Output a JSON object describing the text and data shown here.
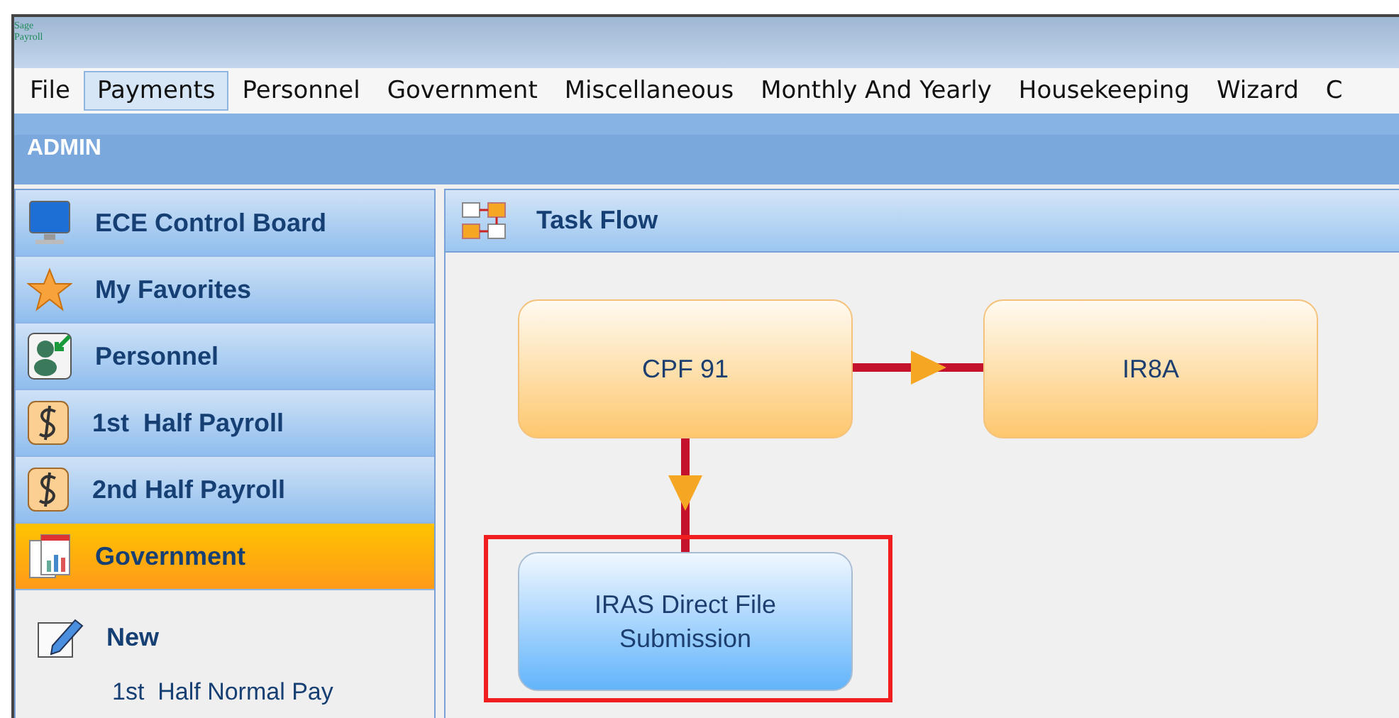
{
  "window": {
    "logo": [
      "Sage",
      "Payroll"
    ]
  },
  "menu": [
    {
      "label": "File",
      "selected": false
    },
    {
      "label": "Payments",
      "selected": true
    },
    {
      "label": "Personnel",
      "selected": false
    },
    {
      "label": "Government",
      "selected": false
    },
    {
      "label": "Miscellaneous",
      "selected": false
    },
    {
      "label": "Monthly And Yearly",
      "selected": false
    },
    {
      "label": "Housekeeping",
      "selected": false
    },
    {
      "label": "Wizard",
      "selected": false
    },
    {
      "label": "C",
      "selected": false
    }
  ],
  "user_bar": {
    "title": "ADMIN"
  },
  "sidebar": {
    "items": [
      {
        "label": "ECE Control Board",
        "selected": false
      },
      {
        "label": "My Favorites",
        "selected": false
      },
      {
        "label": "Personnel",
        "selected": false
      },
      {
        "label": "1st  Half Payroll",
        "selected": false
      },
      {
        "label": "2nd Half Payroll",
        "selected": false
      },
      {
        "label": "Government",
        "selected": true
      }
    ],
    "sub_items": [
      {
        "label": "New",
        "kind": "icon"
      },
      {
        "label": "1st  Half Normal Pay",
        "kind": "plain"
      }
    ]
  },
  "task_flow": {
    "title": "Task Flow",
    "nodes": [
      {
        "label": "CPF 91",
        "selected": false
      },
      {
        "label": "IR8A",
        "selected": false
      },
      {
        "label": "IRAS Direct File Submission",
        "selected": true
      }
    ]
  }
}
